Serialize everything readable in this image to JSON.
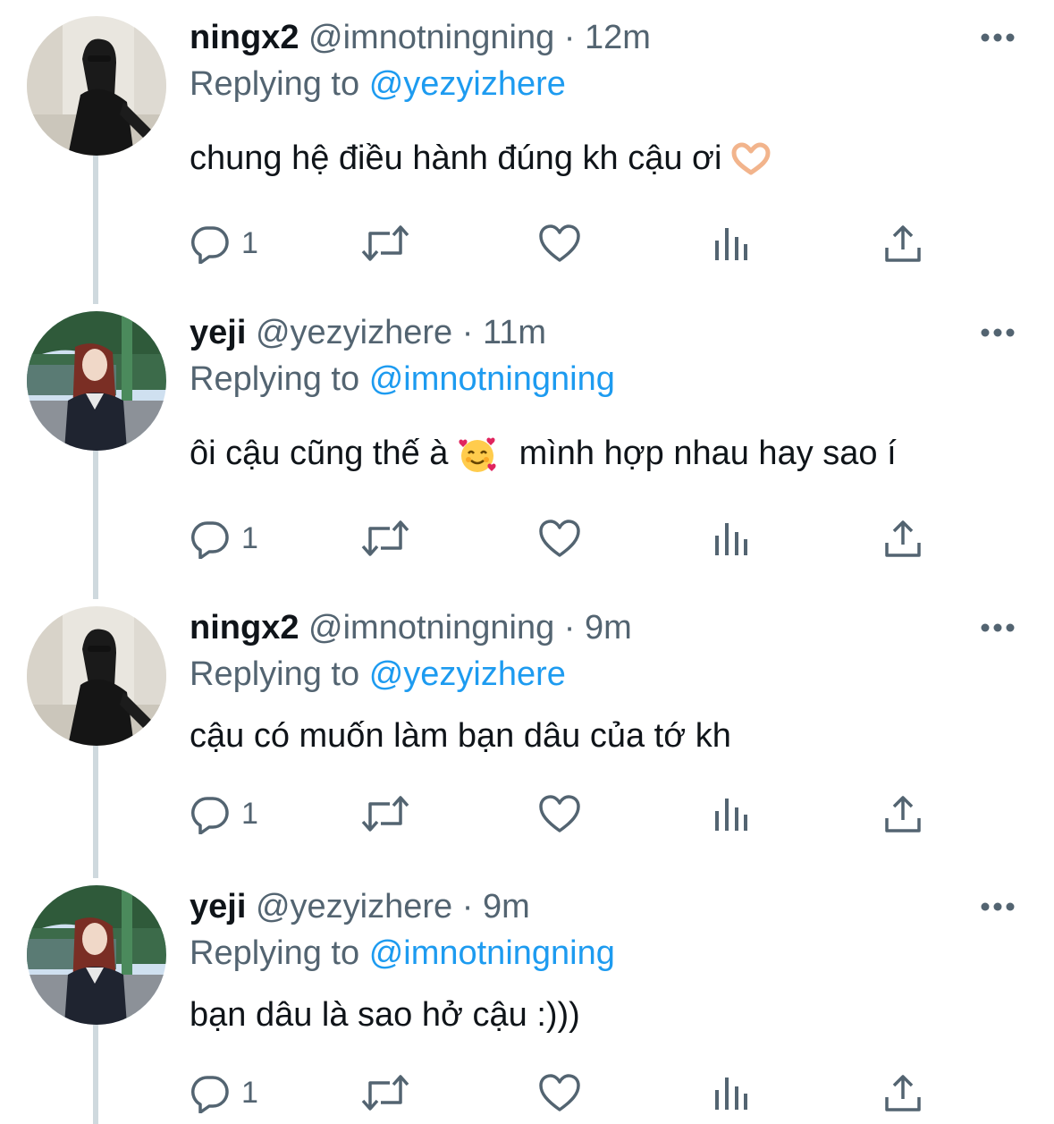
{
  "tweets": [
    {
      "display_name": "ningx2",
      "handle": "@imnotningning",
      "separator": " · ",
      "time": "12m",
      "replying_prefix": "Replying to",
      "replying_to": "@yezyizhere",
      "text": "chung hệ điều hành đúng kh cậu ơi",
      "reply_count": "1"
    },
    {
      "display_name": "yeji",
      "handle": "@yezyizhere",
      "separator": " · ",
      "time": "11m",
      "replying_prefix": "Replying to",
      "replying_to": "@imnotningning",
      "text": "ôi cậu cũng thế à",
      "text_after_emoji": "mình hợp nhau hay sao í",
      "reply_count": "1"
    },
    {
      "display_name": "ningx2",
      "handle": "@imnotningning",
      "separator": " · ",
      "time": "9m",
      "replying_prefix": "Replying to",
      "replying_to": "@yezyizhere",
      "text": "cậu có muốn làm bạn dâu của tớ kh",
      "reply_count": "1"
    },
    {
      "display_name": "yeji",
      "handle": "@yezyizhere",
      "separator": " · ",
      "time": "9m",
      "replying_prefix": "Replying to",
      "replying_to": "@imnotningning",
      "text": "bạn dâu là sao hở cậu :)))",
      "reply_count": "1"
    }
  ],
  "icons": {
    "reply": "reply-icon",
    "retweet": "retweet-icon",
    "like": "heart-icon",
    "views": "analytics-icon",
    "share": "share-icon",
    "more": "more-icon",
    "emoji_heart_hands": "heart-hands-emoji",
    "emoji_smiling_hearts": "smiling-face-with-hearts-emoji"
  },
  "colors": {
    "text": "#0f1419",
    "secondary": "#536471",
    "link": "#1d9bf0",
    "thread_line": "#cfd9de"
  }
}
